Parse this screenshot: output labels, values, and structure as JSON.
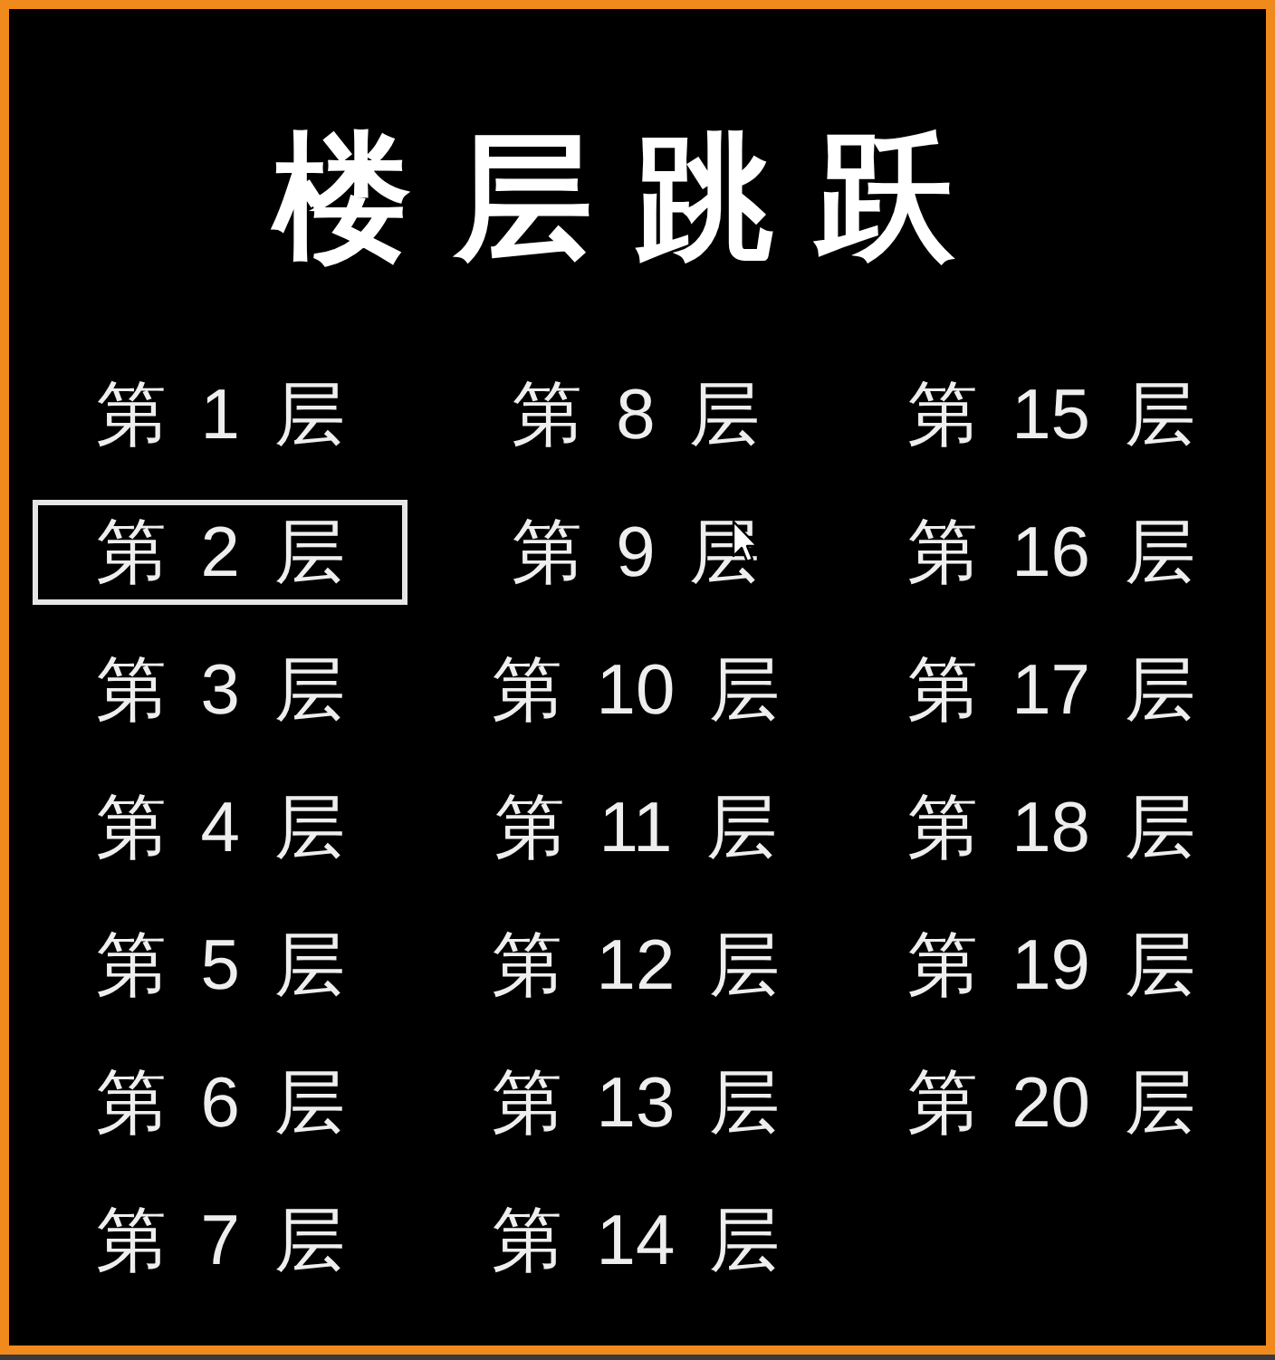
{
  "title": "楼层跳跃",
  "floors": [
    {
      "label": "第 1 层",
      "selected": false,
      "hovered": false
    },
    {
      "label": "第 2 层",
      "selected": true,
      "hovered": false
    },
    {
      "label": "第 3 层",
      "selected": false,
      "hovered": false
    },
    {
      "label": "第 4 层",
      "selected": false,
      "hovered": false
    },
    {
      "label": "第 5 层",
      "selected": false,
      "hovered": false
    },
    {
      "label": "第 6 层",
      "selected": false,
      "hovered": false
    },
    {
      "label": "第 7 层",
      "selected": false,
      "hovered": false
    },
    {
      "label": "第 8 层",
      "selected": false,
      "hovered": false
    },
    {
      "label": "第 9 层",
      "selected": false,
      "hovered": true
    },
    {
      "label": "第 10 层",
      "selected": false,
      "hovered": false
    },
    {
      "label": "第 11 层",
      "selected": false,
      "hovered": false
    },
    {
      "label": "第 12 层",
      "selected": false,
      "hovered": false
    },
    {
      "label": "第 13 层",
      "selected": false,
      "hovered": false
    },
    {
      "label": "第 14 层",
      "selected": false,
      "hovered": false
    },
    {
      "label": "第 15 层",
      "selected": false,
      "hovered": false
    },
    {
      "label": "第 16 层",
      "selected": false,
      "hovered": false
    },
    {
      "label": "第 17 层",
      "selected": false,
      "hovered": false
    },
    {
      "label": "第 18 层",
      "selected": false,
      "hovered": false
    },
    {
      "label": "第 19 层",
      "selected": false,
      "hovered": false
    },
    {
      "label": "第 20 层",
      "selected": false,
      "hovered": false
    }
  ]
}
